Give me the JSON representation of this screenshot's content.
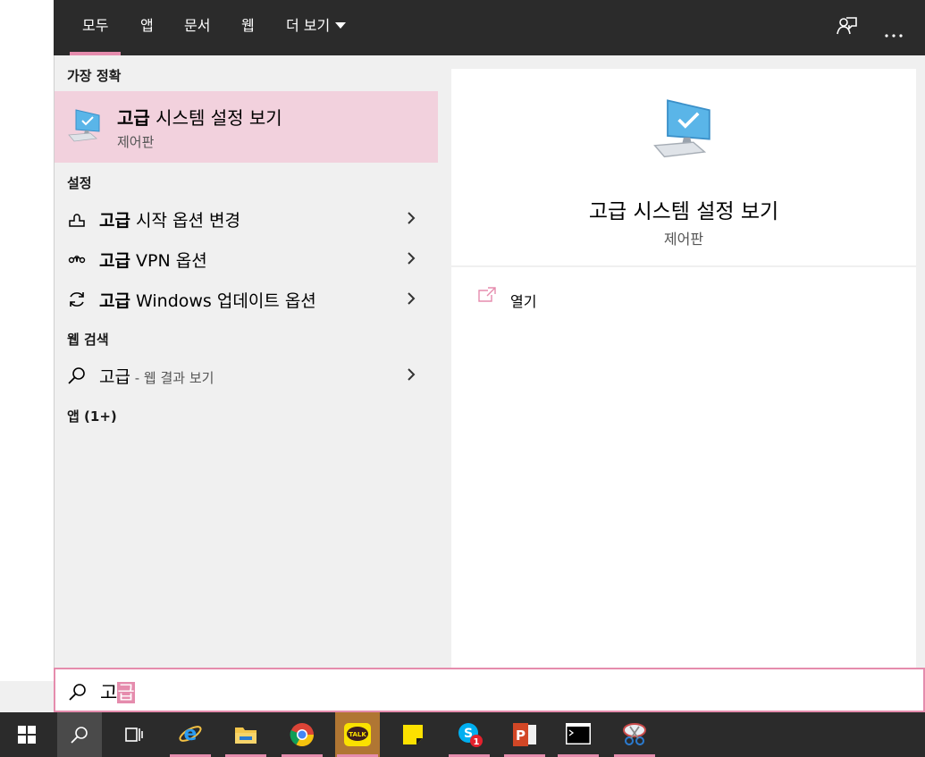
{
  "tabs": {
    "all": "모두",
    "apps": "앱",
    "documents": "문서",
    "web": "웹",
    "more": "더 보기"
  },
  "left": {
    "best_match_header": "가장 정확",
    "best": {
      "highlight": "고급",
      "title_rest": " 시스템 설정 보기",
      "subtitle": "제어판"
    },
    "settings_header": "설정",
    "settings": [
      {
        "highlight": "고급",
        "rest": " 시작 옵션 변경"
      },
      {
        "highlight": "고급",
        "rest": " VPN 옵션"
      },
      {
        "highlight": "고급",
        "rest": " Windows 업데이트 옵션"
      }
    ],
    "web_header": "웹 검색",
    "web": {
      "query": "고급",
      "suffix": " - 웹 결과 보기"
    },
    "apps_header": "앱 (1+)"
  },
  "right": {
    "title": "고급 시스템 설정 보기",
    "subtitle": "제어판",
    "open_label": "열기"
  },
  "search": {
    "typed": "고",
    "composing": "급"
  },
  "taskbar": {
    "icons": [
      "windows-start-icon",
      "search-icon",
      "task-view-icon",
      "internet-explorer-icon",
      "file-explorer-icon",
      "chrome-icon",
      "kakaotalk-icon",
      "sticky-notes-icon",
      "skype-icon",
      "powerpoint-icon",
      "command-prompt-icon",
      "snipping-tool-icon"
    ],
    "kakao_label": "TALK",
    "powerpoint_label": "P",
    "skype_badge": "1"
  },
  "colors": {
    "accent": "#e58cad",
    "selected_bg": "#f2d1dd",
    "dark_bar": "#2b2b2b",
    "panel_bg": "#f0f0f0"
  }
}
